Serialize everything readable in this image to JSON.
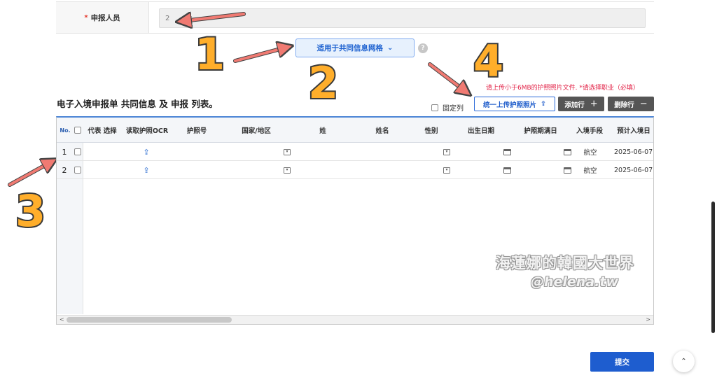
{
  "applicant": {
    "required_mark": "*",
    "label": "申报人员",
    "value": "2"
  },
  "apply_button": {
    "label": "适用于共同信息网格",
    "chevron": "chevron-down-icon"
  },
  "help_icon": {
    "glyph": "?"
  },
  "callouts": [
    "1",
    "2",
    "3",
    "4"
  ],
  "notice": "请上传小于6MB的护照照片文件. *请选择职业（必填）",
  "section_title": "电子入境申报单 共同信息 及 申报 列表。",
  "toolbar": {
    "fixed_column_label": "固定列",
    "upload_all_label": "统一上传护照照片",
    "add_row_label": "添加行",
    "add_row_symbol": "+",
    "delete_row_label": "删除行",
    "delete_row_symbol": "−"
  },
  "grid": {
    "columns": [
      "No.",
      "代表 选择",
      "读取护照OCR",
      "护照号",
      "国家/地区",
      "姓",
      "姓名",
      "性别",
      "出生日期",
      "护照期满日",
      "入境手段",
      "预计入境日"
    ],
    "rows": [
      {
        "no": "1",
        "transport": "航空",
        "entry_date": "2025-06-07"
      },
      {
        "no": "2",
        "transport": "航空",
        "entry_date": "2025-06-07"
      }
    ],
    "scroll_left": "<",
    "scroll_right": ">"
  },
  "watermark": {
    "line1": "海蓮娜的韓國大世界",
    "line2": "@helena.tw"
  },
  "submit_label": "提交",
  "scroll_top_glyph": "⌃",
  "colors": {
    "primary": "#1e5dcf",
    "callout": "#ffae2b",
    "arrow": "#f07a72",
    "notice": "#e22146"
  }
}
